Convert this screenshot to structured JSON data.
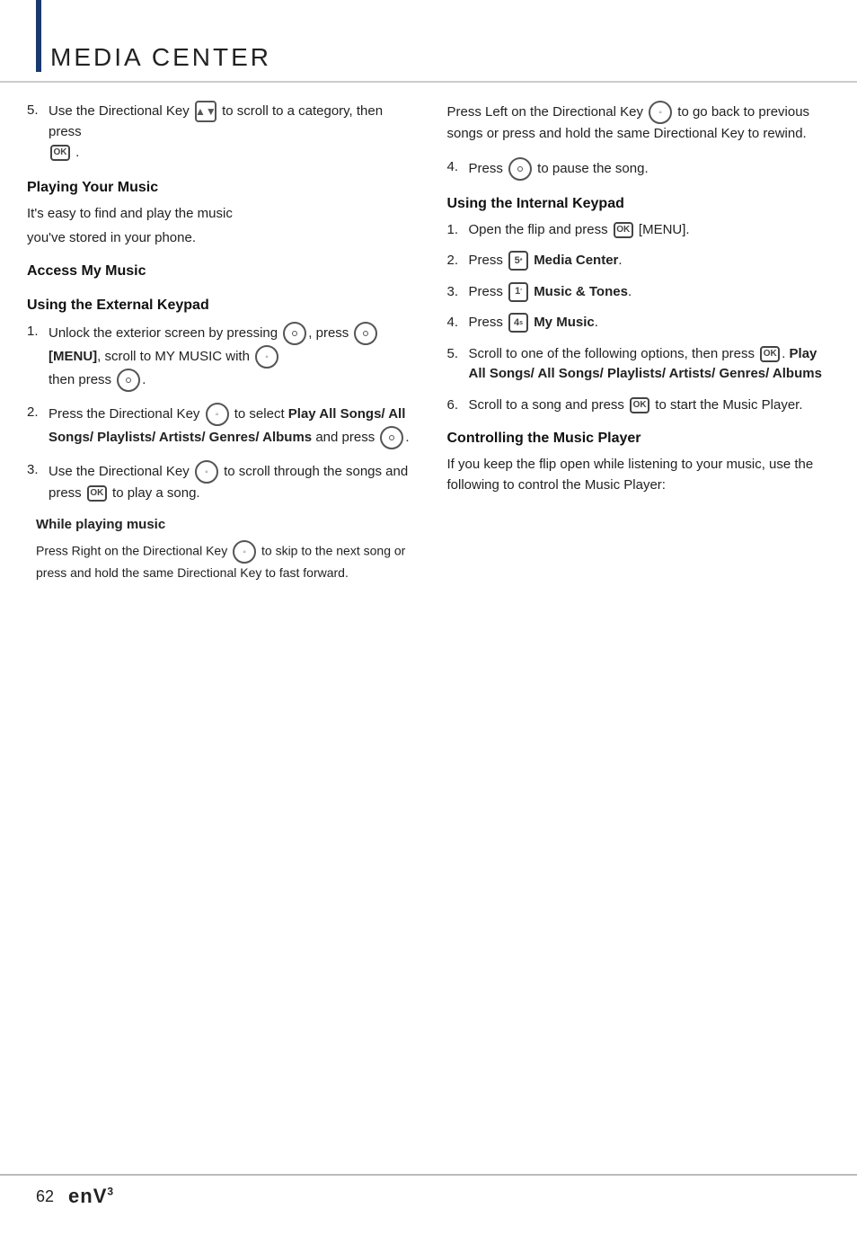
{
  "page": {
    "title": "MEDIA CENTER",
    "footer": {
      "page_number": "62",
      "logo": "enV",
      "logo_sup": "3"
    }
  },
  "left_col": {
    "intro_step": {
      "num": "5.",
      "text_before": "Use the Directional Key",
      "text_after": "to scroll to a category, then press",
      "ok_label": "OK",
      "period": "."
    },
    "playing_heading": "Playing Your Music",
    "playing_intro1": "It's easy to find and play the music",
    "playing_intro2": "you've stored in your phone.",
    "access_heading": "Access My Music",
    "ext_keypad_heading": "Using the External Keypad",
    "steps": [
      {
        "num": "1.",
        "text": "Unlock the exterior screen by pressing",
        "menu_label": "[MENU]",
        "text2": ", scroll to MY MUSIC with",
        "text3": "then press",
        "ok_label": "OK",
        "period": "."
      },
      {
        "num": "2.",
        "text": "Press the Directional Key",
        "text2": "to select",
        "bold_text": "Play All Songs/ All Songs/ Playlists/ Artists/ Genres/ Albums",
        "text3": "and press",
        "ok_label": "OK",
        "period": "."
      },
      {
        "num": "3.",
        "text": "Use the Directional Key",
        "text2": "to scroll through the songs and press",
        "ok_label": "OK",
        "text3": "to play a song."
      }
    ],
    "while_playing": {
      "heading": "While playing music",
      "right_text": "Press Right on the Directional Key",
      "right_text2": "to skip to the next song or press and hold the same Directional Key to fast forward.",
      "left_text": "Press Left on the Directional Key",
      "left_text2": "to go back to previous songs or press and hold the same Directional Key to rewind."
    }
  },
  "right_col": {
    "while_cont": {
      "text": "Press Left on the Directional Key",
      "text2": "to go back to previous songs or press and hold the same Directional Key to rewind."
    },
    "step4": {
      "num": "4.",
      "text": "Press",
      "ok_label": "OK",
      "text2": "to pause the song."
    },
    "internal_heading": "Using the Internal Keypad",
    "steps": [
      {
        "num": "1.",
        "text": "Open the flip and press",
        "ok_label": "OK",
        "text2": "[MENU]."
      },
      {
        "num": "2.",
        "text": "Press",
        "key": "5",
        "bold_text": "Media Center."
      },
      {
        "num": "3.",
        "text": "Press",
        "key": "1",
        "bold_text": "Music & Tones."
      },
      {
        "num": "4.",
        "text": "Press",
        "key": "4",
        "bold_text": "My Music."
      },
      {
        "num": "5.",
        "text": "Scroll to one of the following options, then press",
        "ok_label": "OK",
        "period": ".",
        "bold_text": "Play All Songs/ All Songs/ Playlists/ Artists/ Genres/ Albums"
      },
      {
        "num": "6.",
        "text": "Scroll to a song and press",
        "ok_label": "OK",
        "text2": "to start the Music Player."
      }
    ],
    "controlling_heading": "Controlling the Music Player",
    "controlling_text": "If you keep the flip open while listening to your music, use the following to control the Music Player:"
  }
}
